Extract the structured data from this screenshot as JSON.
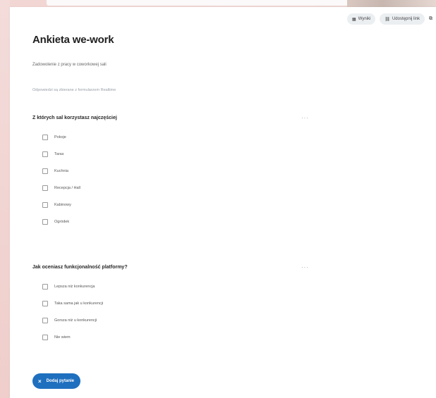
{
  "toolbar": {
    "buttons": [
      {
        "label": "Wyniki",
        "icon": "chart-icon"
      },
      {
        "label": "Udostępnij link",
        "icon": "link-icon"
      }
    ]
  },
  "survey": {
    "title": "Ankieta we-work",
    "subtitle": "Zadowolenie z pracy w coworkowej sali",
    "note": "Odpowiedzi są zbierane z formularzem Realtime",
    "questions": [
      {
        "title": "Z których sal korzystasz najczęściej",
        "options": [
          "Pokoje",
          "Taras",
          "Kuchnia",
          "Recepcja / Hall",
          "Kabinowy",
          "Ogródek"
        ]
      },
      {
        "title": "Jak oceniasz funkcjonalność platformy?",
        "options": [
          "Lepsza niż konkurencja",
          "Taka sama jak u konkurencji",
          "Gorsza niż u konkurencji",
          "Nie wiem"
        ]
      }
    ],
    "add_question_label": "Dodaj pytanie"
  },
  "colors": {
    "accent": "#1f6fbf",
    "background": "#f1d3d0"
  }
}
